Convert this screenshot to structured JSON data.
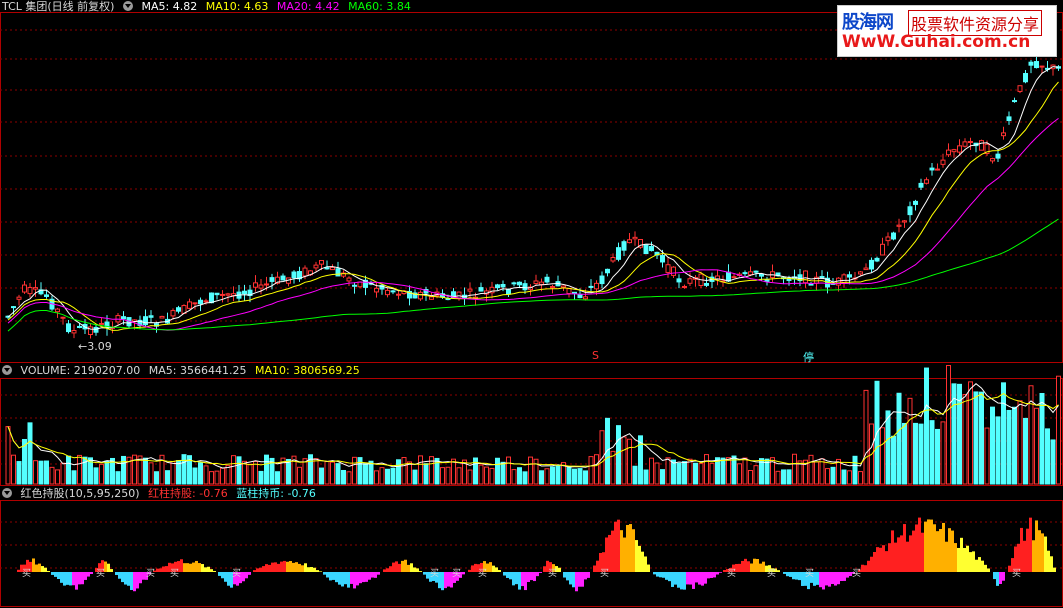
{
  "price_panel": {
    "stock_name": "TCL 集团(日线 前复权)",
    "ma5_label": "MA5:",
    "ma5_value": "4.82",
    "ma10_label": "MA10:",
    "ma10_value": "4.63",
    "ma20_label": "MA20:",
    "ma20_value": "4.42",
    "ma60_label": "MA60:",
    "ma60_value": "3.84",
    "low_marker": "←3.09",
    "signal_s": "S",
    "signal_ting": "停"
  },
  "volume_panel": {
    "title": "VOLUME:",
    "value": "2190207.00",
    "ma5_label": "MA5:",
    "ma5_value": "3566441.25",
    "ma10_label": "MA10:",
    "ma10_value": "3806569.25"
  },
  "indicator_panel": {
    "title": "红色持股(10,5,95,250)",
    "red_label": "红柱持股:",
    "red_value": "-0.76",
    "blue_label": "蓝柱持币:",
    "blue_value": "-0.76",
    "marker_text": "买"
  },
  "watermark": {
    "brand": "股海网",
    "slogan": "股票软件资源分享",
    "url": "WwW.Guhai.com.cn"
  },
  "colors": {
    "up": "#ff3232",
    "down": "#54ffff",
    "ma5": "#ffffff",
    "ma10": "#ffff00",
    "ma20": "#ff00ff",
    "ma60": "#00ff00",
    "grid": "#8b0000",
    "border": "#b00000"
  }
}
